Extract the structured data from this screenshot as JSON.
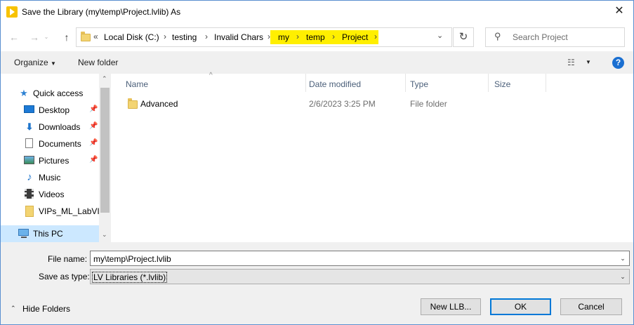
{
  "window": {
    "title": "Save the Library (my\\temp\\Project.lvlib) As",
    "close": "✕"
  },
  "nav": {
    "back": "←",
    "forward": "→",
    "up": "↑",
    "overflow": "«",
    "crumbs": [
      "Local Disk (C:)",
      "testing",
      "Invalid Chars",
      "my",
      "temp",
      "Project"
    ],
    "highlight_color": "#ffef00",
    "refresh": "↻",
    "search_placeholder": "Search Project"
  },
  "toolbar": {
    "organize": "Organize",
    "new_folder": "New folder",
    "help": "?"
  },
  "sidebar": {
    "items": [
      {
        "label": "Quick access",
        "icon": "star-icon"
      },
      {
        "label": "Desktop",
        "icon": "desktop-icon",
        "pinned": true
      },
      {
        "label": "Downloads",
        "icon": "download-icon",
        "pinned": true
      },
      {
        "label": "Documents",
        "icon": "document-icon",
        "pinned": true
      },
      {
        "label": "Pictures",
        "icon": "picture-icon",
        "pinned": true
      },
      {
        "label": "Music",
        "icon": "music-icon"
      },
      {
        "label": "Videos",
        "icon": "video-icon"
      },
      {
        "label": "VIPs_ML_LabVIEW",
        "icon": "folder-icon"
      },
      {
        "label": "This PC",
        "icon": "computer-icon",
        "selected": true
      }
    ]
  },
  "files": {
    "columns": [
      "Name",
      "Date modified",
      "Type",
      "Size"
    ],
    "rows": [
      {
        "name": "Advanced",
        "date": "2/6/2023 3:25 PM",
        "type": "File folder",
        "size": ""
      }
    ]
  },
  "form": {
    "file_name_label": "File name:",
    "file_name_value": "my\\temp\\Project.lvlib",
    "save_type_label": "Save as type:",
    "save_type_value": "LV Libraries (*.lvlib)"
  },
  "footer": {
    "hide_folders": "Hide Folders",
    "new_llb": "New LLB...",
    "ok": "OK",
    "cancel": "Cancel"
  }
}
